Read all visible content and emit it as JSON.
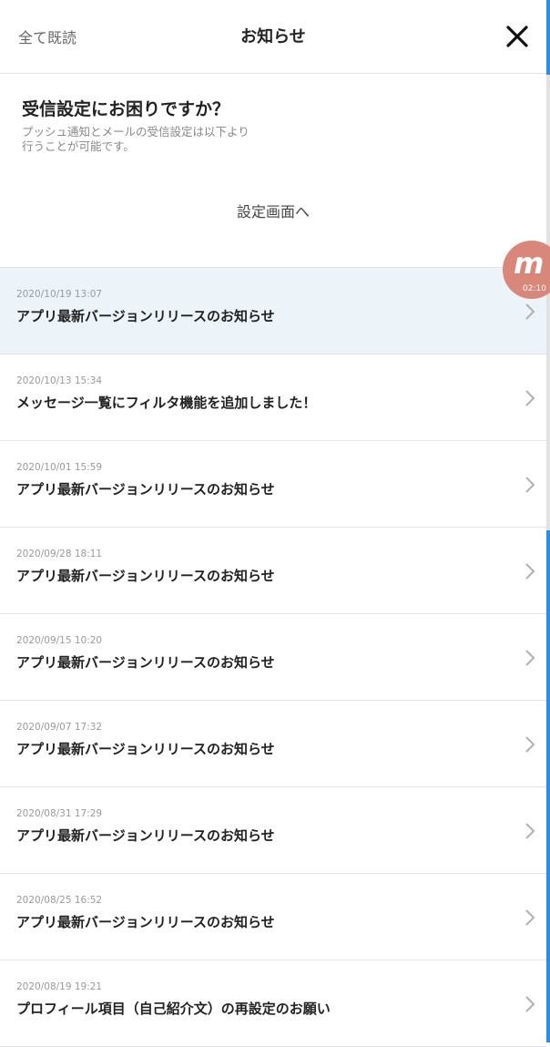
{
  "header": {
    "mark_all_read": "全て既読",
    "title": "お知らせ",
    "close_icon": "close-icon"
  },
  "settings_help": {
    "heading": "受信設定にお困りですか？",
    "desc_line1": "プッシュ通知とメールの受信設定は以下より",
    "desc_line2": "行うことが可能です。",
    "link": "設定画面へ"
  },
  "notifications": [
    {
      "date": "2020/10/19 13:07",
      "title": "アプリ最新バージョンリリースのお知らせ",
      "unread": true
    },
    {
      "date": "2020/10/13 15:34",
      "title": "メッセージ一覧にフィルタ機能を追加しました！",
      "unread": false
    },
    {
      "date": "2020/10/01 15:59",
      "title": "アプリ最新バージョンリリースのお知らせ",
      "unread": false
    },
    {
      "date": "2020/09/28 18:11",
      "title": "アプリ最新バージョンリリースのお知らせ",
      "unread": false
    },
    {
      "date": "2020/09/15 10:20",
      "title": "アプリ最新バージョンリリースのお知らせ",
      "unread": false
    },
    {
      "date": "2020/09/07 17:32",
      "title": "アプリ最新バージョンリリースのお知らせ",
      "unread": false
    },
    {
      "date": "2020/08/31 17:29",
      "title": "アプリ最新バージョンリリースのお知らせ",
      "unread": false
    },
    {
      "date": "2020/08/25 16:52",
      "title": "アプリ最新バージョンリリースのお知らせ",
      "unread": false
    },
    {
      "date": "2020/08/19 19:21",
      "title": "プロフィール項目（自己紹介文）の再設定のお願い",
      "unread": false
    }
  ],
  "floating_badge": {
    "glyph": "m",
    "time": "02:10",
    "color": "#d9877a"
  },
  "colors": {
    "unread_bg": "#ecf4f9",
    "accent": "#2f8ce6"
  }
}
